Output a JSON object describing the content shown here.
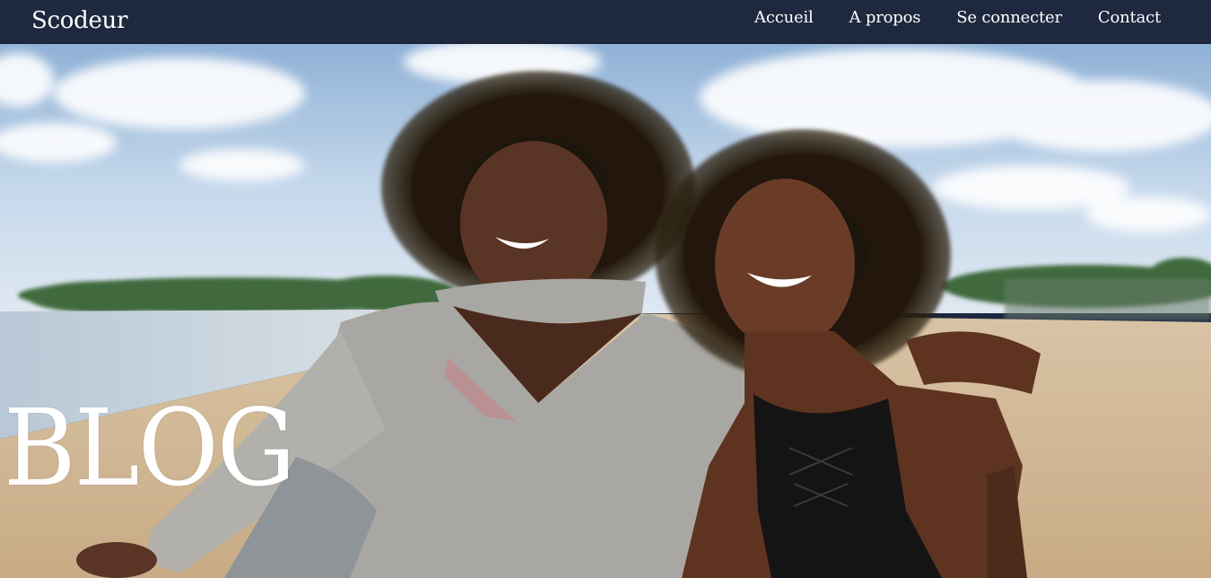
{
  "navbar": {
    "brand": "Scodeur",
    "links": [
      {
        "label": "Accueil"
      },
      {
        "label": "A propos"
      },
      {
        "label": "Se connecter"
      },
      {
        "label": "Contact"
      }
    ]
  },
  "hero": {
    "title": "BLOG",
    "image_alt": "Deux femmes souriantes sur une plage"
  },
  "colors": {
    "navbar_bg": "#1e293f",
    "nav_text": "#ffffff",
    "hero_title": "#ffffff"
  }
}
